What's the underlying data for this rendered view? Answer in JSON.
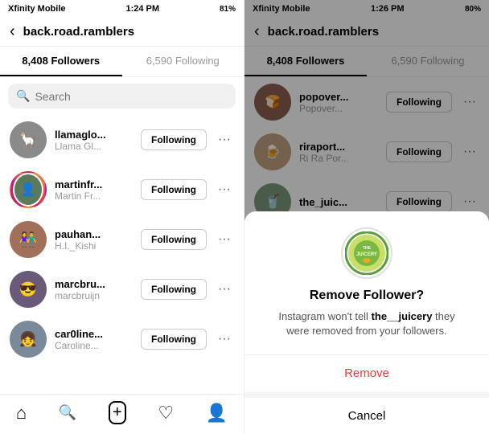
{
  "left": {
    "status_bar": {
      "carrier": "Xfinity Mobile",
      "time": "1:24 PM",
      "battery": "81%"
    },
    "header": {
      "back_label": "‹",
      "title": "back.road.ramblers"
    },
    "tabs": [
      {
        "label": "8,408 Followers",
        "active": true
      },
      {
        "label": "6,590 Following",
        "active": false
      }
    ],
    "search": {
      "placeholder": "Search"
    },
    "followers": [
      {
        "username": "llamaglo...",
        "fullname": "Llama Gl...",
        "btn": "Following",
        "has_story": false,
        "color": "avatar-1"
      },
      {
        "username": "martinfr...",
        "fullname": "Martin Fr...",
        "btn": "Following",
        "has_story": true,
        "color": "avatar-2"
      },
      {
        "username": "pauhan...",
        "fullname": "H.I._Kishi",
        "btn": "Following",
        "has_story": false,
        "color": "avatar-3"
      },
      {
        "username": "marcbru...",
        "fullname": "marcbruijn",
        "btn": "Following",
        "has_story": false,
        "color": "avatar-4"
      },
      {
        "username": "car0line...",
        "fullname": "Caroline...",
        "btn": "Following",
        "has_story": false,
        "color": "avatar-5"
      }
    ],
    "bottom_nav": [
      "🏠",
      "🔍",
      "➕",
      "♡",
      "👤"
    ]
  },
  "right": {
    "status_bar": {
      "carrier": "Xfinity Mobile",
      "time": "1:26 PM",
      "battery": "80%"
    },
    "header": {
      "back_label": "‹",
      "title": "back.road.ramblers"
    },
    "tabs": [
      {
        "label": "8,408 Followers",
        "active": true
      },
      {
        "label": "6,590 Following",
        "active": false
      }
    ],
    "followers": [
      {
        "username": "popover...",
        "fullname": "Popover...",
        "btn": "Following",
        "color": "avatar-r1"
      },
      {
        "username": "riraport...",
        "fullname": "Ri Ra Por...",
        "btn": "Following",
        "color": "avatar-r2"
      },
      {
        "username": "the_juic...",
        "fullname": "",
        "btn": "Following",
        "color": "avatar-r3"
      }
    ],
    "modal": {
      "title": "Remove Follower?",
      "description_prefix": "Instagram won't tell ",
      "username": "the__juicery",
      "description_suffix": " they were removed from your followers.",
      "remove_label": "Remove",
      "cancel_label": "Cancel"
    }
  }
}
